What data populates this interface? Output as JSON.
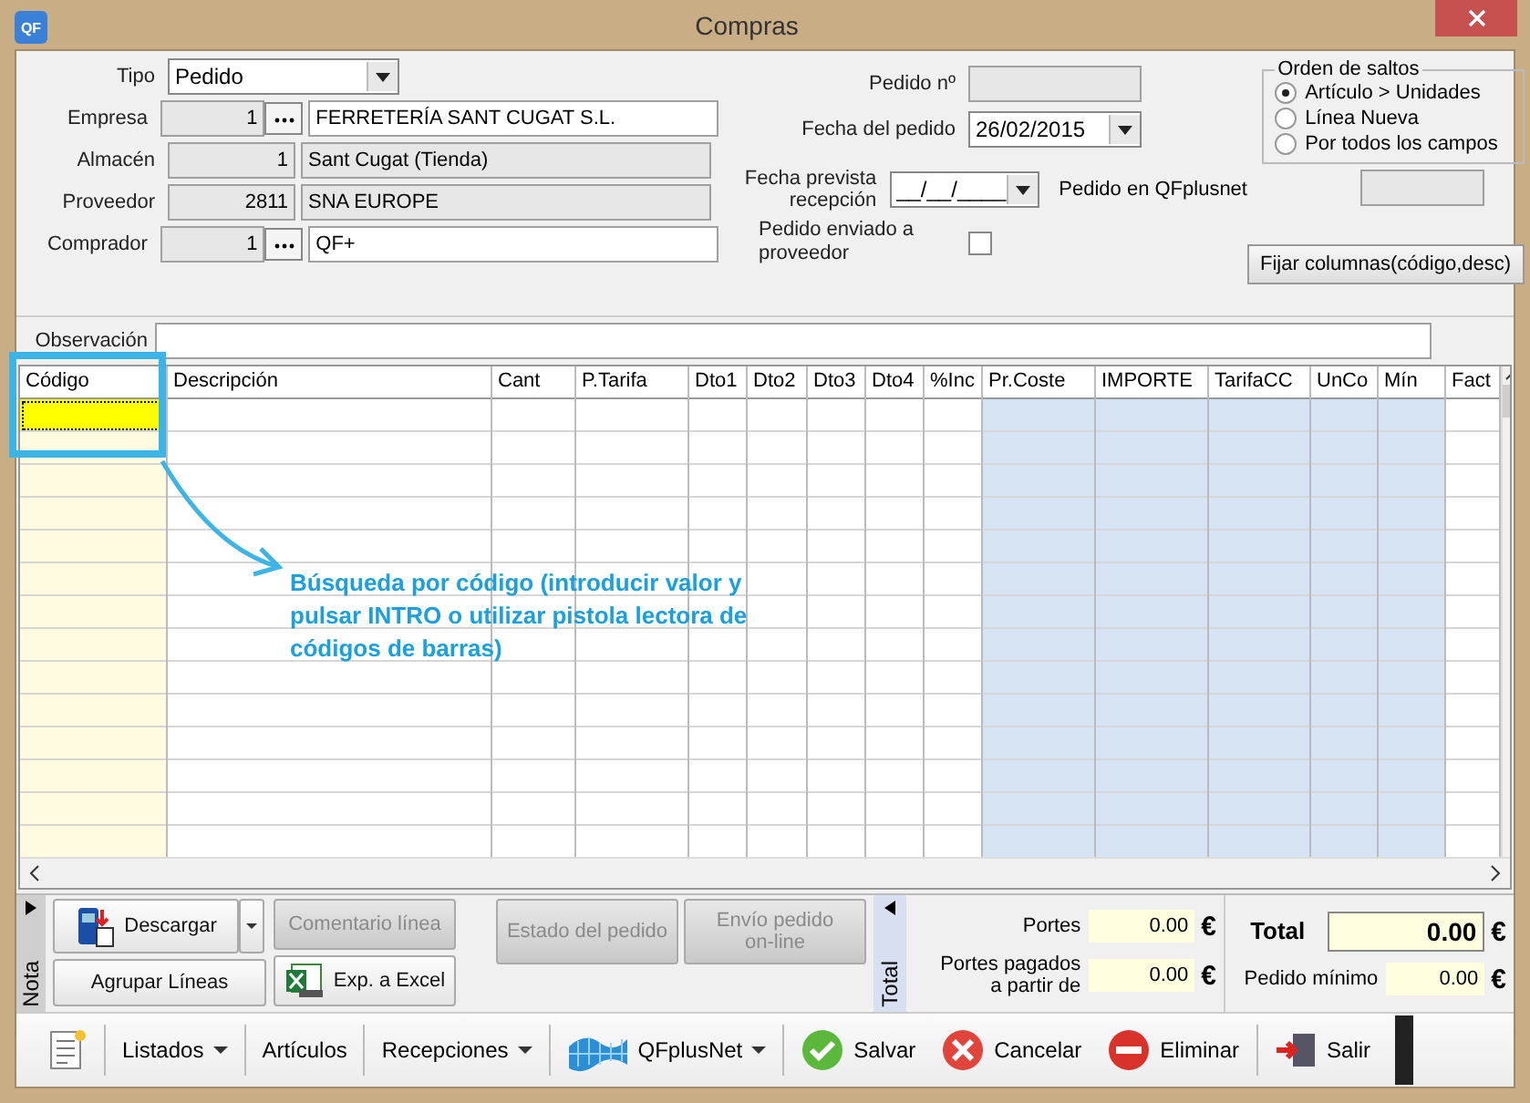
{
  "window": {
    "title": "Compras",
    "app_icon": "QF"
  },
  "header": {
    "tipo": {
      "label": "Tipo",
      "value": "Pedido"
    },
    "empresa": {
      "label": "Empresa",
      "code": "1",
      "name": "FERRETERÍA SANT CUGAT S.L."
    },
    "almacen": {
      "label": "Almacén",
      "code": "1",
      "name": "Sant Cugat (Tienda)"
    },
    "proveedor": {
      "label": "Proveedor",
      "code": "2811",
      "name": "SNA EUROPE"
    },
    "comprador": {
      "label": "Comprador",
      "code": "1",
      "name": "QF+"
    },
    "pedido_no": {
      "label": "Pedido nº"
    },
    "fecha_pedido": {
      "label": "Fecha del pedido",
      "value": "26/02/2015"
    },
    "fecha_prevista": {
      "label": "Fecha prevista recepción",
      "value": "__/__/____"
    },
    "pedido_qfplusnet": {
      "label": "Pedido en QFplusnet"
    },
    "enviado": {
      "label": "Pedido enviado a proveedor",
      "checked": false
    },
    "orden_saltos": {
      "title": "Orden de saltos",
      "options": [
        {
          "label": "Artículo > Unidades",
          "selected": true
        },
        {
          "label": "Línea Nueva",
          "selected": false
        },
        {
          "label": "Por todos los campos",
          "selected": false
        }
      ]
    },
    "fijar_button": "Fijar columnas(código,desc)",
    "observacion": {
      "label": "Observación"
    }
  },
  "table": {
    "columns": [
      {
        "label": "Código",
        "kind": "key"
      },
      {
        "label": "Descripción",
        "kind": "input"
      },
      {
        "label": "Cant",
        "kind": "input"
      },
      {
        "label": "P.Tarifa",
        "kind": "input"
      },
      {
        "label": "Dto1",
        "kind": "input"
      },
      {
        "label": "Dto2",
        "kind": "input"
      },
      {
        "label": "Dto3",
        "kind": "input"
      },
      {
        "label": "Dto4",
        "kind": "input"
      },
      {
        "label": "%Inc",
        "kind": "input"
      },
      {
        "label": "Pr.Coste",
        "kind": "calculated"
      },
      {
        "label": "IMPORTE",
        "kind": "calculated"
      },
      {
        "label": "TarifaCC",
        "kind": "calculated"
      },
      {
        "label": "UnCo",
        "kind": "calculated"
      },
      {
        "label": "Mín",
        "kind": "calculated"
      },
      {
        "label": "Fact",
        "kind": "input"
      }
    ]
  },
  "annotation": "Búsqueda por código (introducir valor y pulsar INTRO o utilizar pistola lectora de códigos de barras)",
  "actions": {
    "nota_tab": "Nota",
    "descargar": "Descargar",
    "agrupar": "Agrupar Líneas",
    "comentario": {
      "label": "Comentario línea",
      "disabled": true
    },
    "excel": "Exp. a Excel",
    "estado": {
      "label": "Estado del pedido",
      "disabled": true
    },
    "envio": {
      "label": "Envío pedido on-line",
      "disabled": true
    }
  },
  "totals": {
    "tab": "Total",
    "portes": {
      "label": "Portes",
      "value": "0.00",
      "currency": "€"
    },
    "portes_pagados": {
      "label": "Portes pagados a partir de",
      "value": "0.00",
      "currency": "€"
    },
    "total": {
      "label": "Total",
      "value": "0.00",
      "currency": "€"
    },
    "minimo": {
      "label": "Pedido mínimo",
      "value": "0.00",
      "currency": "€"
    }
  },
  "toolbar": [
    {
      "label": "Listados",
      "kind": "menu"
    },
    {
      "label": "Artículos",
      "kind": "plain"
    },
    {
      "label": "Recepciones",
      "kind": "menu"
    },
    {
      "label": "QFplusNet",
      "kind": "net"
    },
    {
      "label": "Salvar",
      "kind": "save"
    },
    {
      "label": "Cancelar",
      "kind": "cancel"
    },
    {
      "label": "Eliminar",
      "kind": "delete"
    },
    {
      "label": "Salir",
      "kind": "exit"
    }
  ]
}
